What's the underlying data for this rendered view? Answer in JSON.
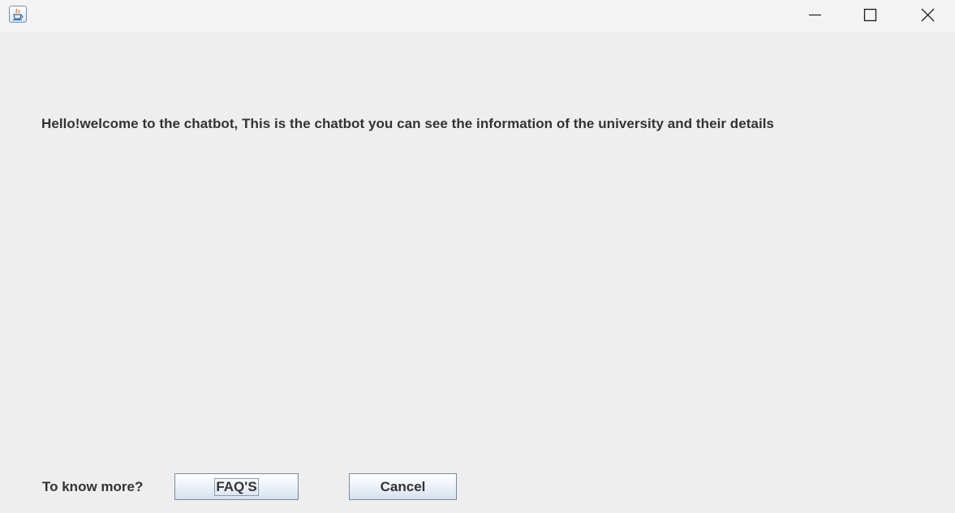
{
  "titlebar": {
    "app_icon": "java-coffee-cup-icon",
    "controls": [
      "minimize-icon",
      "maximize-icon",
      "close-icon"
    ]
  },
  "main": {
    "welcome_text": "Hello!welcome to the chatbot, This is the chatbot you can see the information of the university and their details",
    "prompt_label": "To know more?",
    "faq_button": "FAQ'S",
    "cancel_button": "Cancel"
  },
  "colors": {
    "window_bg": "#eeeeee",
    "titlebar_bg": "#f3f3f3",
    "text": "#333333",
    "button_border": "#7a8a9e"
  }
}
